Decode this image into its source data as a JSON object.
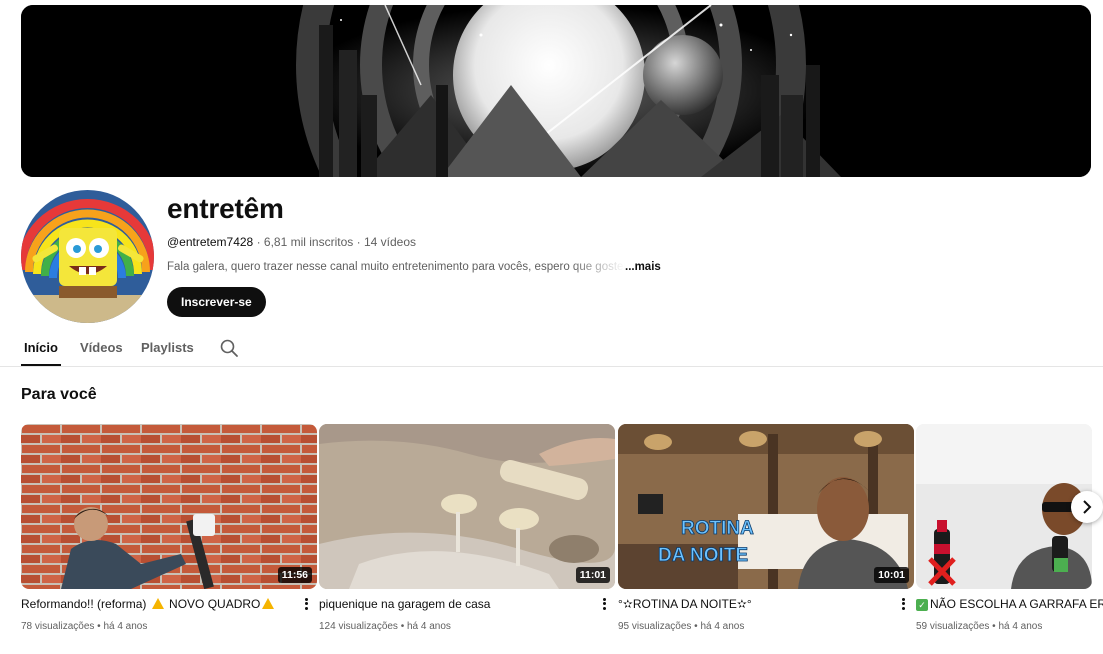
{
  "channel": {
    "name": "entretêm",
    "handle": "@entretem7428",
    "separator": " · ",
    "subscribers": "6,81 mil inscritos",
    "videos": "14 vídeos",
    "description": "Fala galera, quero trazer nesse canal muito entretenimento para vocês, espero que gostem",
    "more_label": "...mais",
    "subscribe_label": "Inscrever-se"
  },
  "tabs": [
    {
      "label": "Início",
      "active": true
    },
    {
      "label": "Vídeos",
      "active": false
    },
    {
      "label": "Playlists",
      "active": false
    }
  ],
  "search_icon": "search-icon",
  "section_title": "Para você",
  "videos": [
    {
      "title_a": "Reformando!! (reforma) ",
      "title_b": " NOVO QUADRO",
      "duration": "11:56",
      "views": "78 visualizações",
      "age": "há 4 anos",
      "sep": " • "
    },
    {
      "title": "piquenique na garagem de casa",
      "duration": "11:01",
      "views": "124 visualizações",
      "age": "há 4 anos",
      "sep": " • "
    },
    {
      "title": "°✫ROTINA DA NOITE✫°",
      "duration": "10:01",
      "views": "95 visualizações",
      "age": "há 4 anos",
      "sep": " • ",
      "thumb_text_1": "ROTINA",
      "thumb_text_2": "DA NOITE"
    },
    {
      "title": "NÃO ESCOLHA A GARRAFA ERRADA",
      "views": "59 visualizações",
      "age": "há 4 anos",
      "sep": " • ",
      "check": "✓"
    }
  ],
  "colors": {
    "accent": "#0f0f0f",
    "secondary_text": "#606060",
    "warn": "#f5b400",
    "check": "#4caf50"
  }
}
